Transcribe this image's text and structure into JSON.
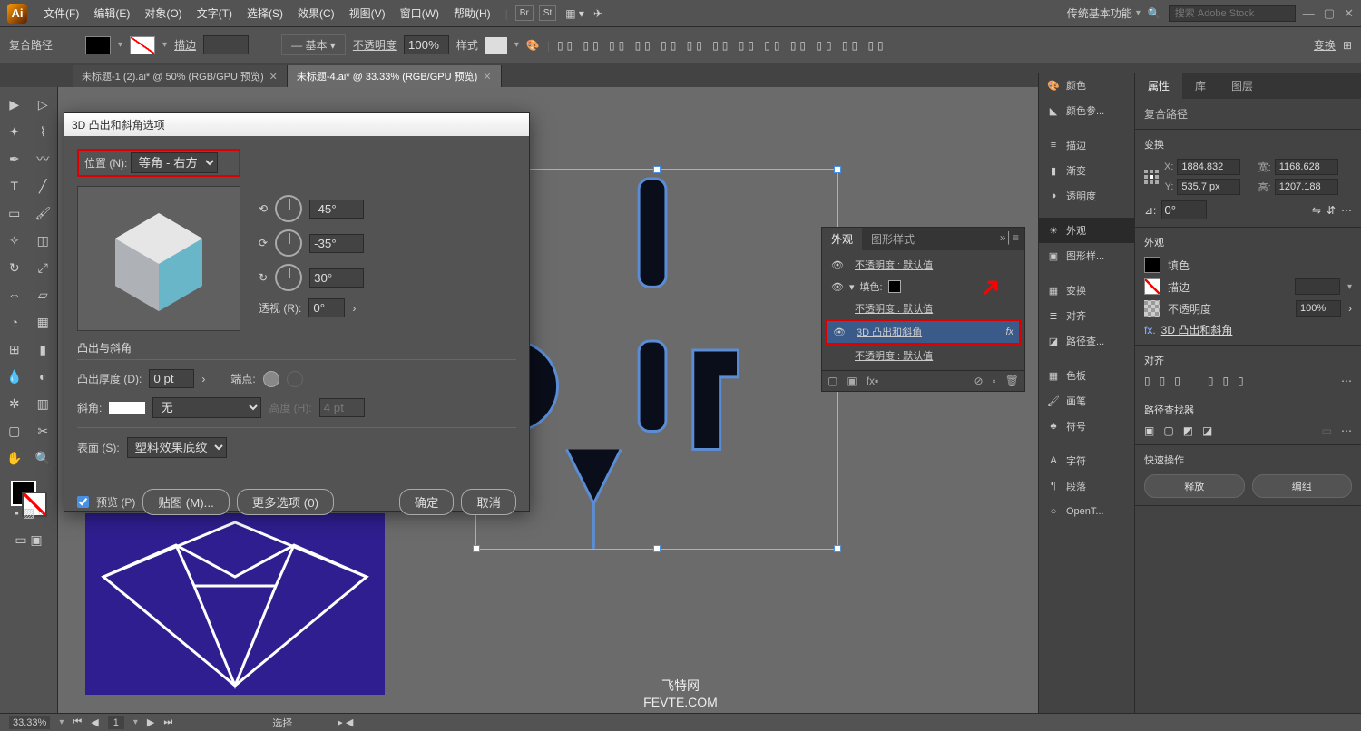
{
  "app": {
    "logo": "Ai"
  },
  "menu": [
    "文件(F)",
    "编辑(E)",
    "对象(O)",
    "文字(T)",
    "选择(S)",
    "效果(C)",
    "视图(V)",
    "窗口(W)",
    "帮助(H)"
  ],
  "workspace_name": "传统基本功能",
  "search_placeholder": "搜索 Adobe Stock",
  "controlbar": {
    "selection_label": "复合路径",
    "stroke_label": "描边",
    "stroke_value": "",
    "style_label": "基本",
    "opacity_label": "不透明度",
    "opacity_value": "100%",
    "prefs_label": "样式",
    "transform_label": "变换"
  },
  "tabs": [
    {
      "title": "未标题-1 (2).ai* @ 50% (RGB/GPU 预览)",
      "active": false
    },
    {
      "title": "未标题-4.ai* @ 33.33% (RGB/GPU 预览)",
      "active": true
    }
  ],
  "dialog": {
    "title": "3D 凸出和斜角选项",
    "position_label": "位置 (N):",
    "position_value": "等角 - 右方",
    "rot_x": "-45°",
    "rot_y": "-35°",
    "rot_z": "30°",
    "perspective_label": "透视 (R):",
    "perspective_value": "0°",
    "extrude_section": "凸出与斜角",
    "extrude_depth_label": "凸出厚度 (D):",
    "extrude_depth_value": "0 pt",
    "cap_label": "端点:",
    "bevel_label": "斜角:",
    "bevel_value": "无",
    "height_label": "高度 (H):",
    "height_value": "4 pt",
    "surface_label": "表面 (S):",
    "surface_value": "塑料效果底纹",
    "preview_label": "预览 (P)",
    "map_art": "贴图 (M)...",
    "more_options": "更多选项 (0)",
    "ok": "确定",
    "cancel": "取消"
  },
  "appearance_panel": {
    "tab1": "外观",
    "tab2": "图形样式",
    "rows": [
      {
        "text": "不透明度 : 默认值"
      },
      {
        "text": "填色:",
        "swatch": true
      },
      {
        "text": "不透明度 : 默认值"
      },
      {
        "text": "3D 凸出和斜角",
        "fx": "fx",
        "selected": true
      },
      {
        "text": "不透明度 : 默认值"
      }
    ]
  },
  "right_dock": [
    "颜色",
    "颜色参...",
    "描边",
    "渐变",
    "透明度",
    "外观",
    "图形样...",
    "变换",
    "对齐",
    "路径查...",
    "色板",
    "画笔",
    "符号",
    "字符",
    "段落",
    "OpenT..."
  ],
  "props": {
    "tabs": [
      "属性",
      "库",
      "图层"
    ],
    "selection_type": "复合路径",
    "transform_title": "变换",
    "x_label": "X:",
    "x": "1884.832",
    "y_label": "Y:",
    "y": "535.7 px",
    "w_label": "宽:",
    "w": "1168.628",
    "h_label": "高:",
    "h": "1207.188",
    "angle_label": "⊿:",
    "angle": "0°",
    "appearance_title": "外观",
    "fill_label": "填色",
    "stroke_label": "描边",
    "opacity_label": "不透明度",
    "opacity_value": "100%",
    "fx_prefix": "fx.",
    "fx_item": "3D 凸出和斜角",
    "align_title": "对齐",
    "pathfinder_title": "路径查找器",
    "quick_title": "快速操作",
    "release_btn": "释放",
    "group_btn": "编组"
  },
  "status": {
    "zoom": "33.33%",
    "label": "选择"
  },
  "watermark": {
    "line1": "飞特网",
    "line2": "FEVTE.COM"
  }
}
